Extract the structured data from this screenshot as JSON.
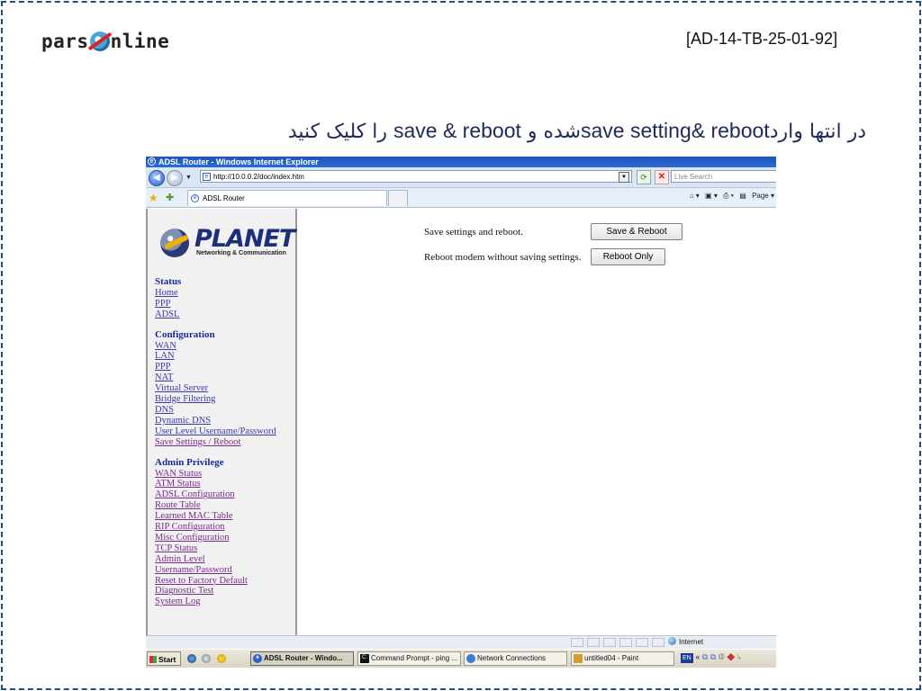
{
  "slide": {
    "logo_text_left": "pars",
    "logo_text_right": "nline",
    "code": "[AD-14-TB-25-01-92]",
    "caption_1": "در انتها وارد",
    "caption_2": "save setting& reboot",
    "caption_3": "شده  و  ",
    "caption_4": "save & reboot",
    "caption_5": " را کلیک کنید"
  },
  "browser": {
    "window_title": "ADSL Router - Windows Internet Explorer",
    "address": "http://10.0.0.2/doc/index.htm",
    "search_placeholder": "Live Search",
    "tab_label": "ADSL Router",
    "page_menu": "Page",
    "status_zone": "Internet"
  },
  "router": {
    "brand": "PLANET",
    "brand_sub": "Networking & Communication",
    "sections": [
      {
        "title": "Status",
        "items": [
          "Home",
          "PPP",
          "ADSL"
        ]
      },
      {
        "title": "Configuration",
        "items": [
          "WAN",
          "LAN",
          "PPP",
          "NAT",
          "Virtual Server",
          "Bridge Filtering",
          "DNS",
          "Dynamic DNS",
          "User Level Username/Password",
          "Save Settings / Reboot"
        ]
      },
      {
        "title": "Admin Privilege",
        "items": [
          "WAN Status",
          "ATM Status",
          "ADSL Configuration",
          "Route Table",
          "Learned MAC Table",
          "RIP Configuration",
          "Misc Configuration",
          "TCP Status",
          "Admin Level",
          "Username/Password",
          "Reset to Factory Default",
          "Diagnostic Test",
          "System Log"
        ]
      }
    ],
    "save_text": "Save settings and reboot.",
    "save_button": "Save & Reboot",
    "reboot_text": "Reboot modem without saving settings.",
    "reboot_button": "Reboot Only"
  },
  "taskbar": {
    "start": "Start",
    "tasks": [
      "ADSL Router - Windo...",
      "Command Prompt - ping ...",
      "Network Connections",
      "untitled04 - Paint"
    ],
    "lang": "EN",
    "chevron": "«"
  },
  "colors": {
    "menu_heading": "#1a2b9a",
    "link": "#3a3aa8",
    "visited_link": "#7a2a8a",
    "titlebar": "#1f55b8"
  }
}
